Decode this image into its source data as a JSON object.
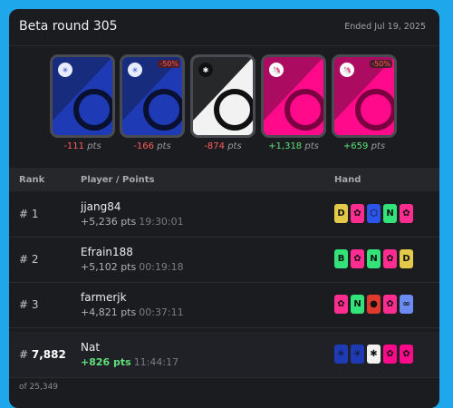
{
  "header": {
    "title": "Beta round 305",
    "ended": "Ended Jul 19, 2025"
  },
  "cards": [
    {
      "coin": "cardano",
      "coin_icon": "✳",
      "bg": "#1e3bb5",
      "coin_bg": "#e8ecff",
      "badge": "",
      "pts": "-111",
      "sign": "neg",
      "unit": "pts"
    },
    {
      "coin": "cardano",
      "coin_icon": "✳",
      "bg": "#1e3bb5",
      "coin_bg": "#e8ecff",
      "badge": "-50%",
      "pts": "-166",
      "sign": "neg",
      "unit": "pts"
    },
    {
      "coin": "stellar",
      "coin_icon": "✱",
      "bg": "#f2f2f2",
      "coin_bg": "#111111",
      "badge": "",
      "pts": "-874",
      "sign": "neg",
      "unit": "pts"
    },
    {
      "coin": "uniswap",
      "coin_icon": "🦄",
      "bg": "#ff0a8a",
      "coin_bg": "#ffffff",
      "badge": "",
      "pts": "+1,318",
      "sign": "pos",
      "unit": "pts"
    },
    {
      "coin": "uniswap",
      "coin_icon": "🦄",
      "bg": "#ff0a8a",
      "coin_bg": "#ffffff",
      "badge": "-50%",
      "pts": "+659",
      "sign": "pos",
      "unit": "pts"
    }
  ],
  "table": {
    "headers": {
      "rank": "Rank",
      "player": "Player / Points",
      "hand": "Hand"
    },
    "rows": [
      {
        "rank_prefix": "#",
        "rank": "1",
        "name": "jjang84",
        "points": "+5,236 pts",
        "time": "19:30:01",
        "hand": [
          {
            "c": "#e3c84a",
            "t": "D"
          },
          {
            "c": "#ff2d8f",
            "t": "✿"
          },
          {
            "c": "#2b54e8",
            "t": "⬡"
          },
          {
            "c": "#34e27a",
            "t": "N"
          },
          {
            "c": "#ff2d8f",
            "t": "✿"
          }
        ]
      },
      {
        "rank_prefix": "#",
        "rank": "2",
        "name": "Efrain188",
        "points": "+5,102 pts",
        "time": "00:19:18",
        "hand": [
          {
            "c": "#34e27a",
            "t": "B"
          },
          {
            "c": "#ff2d8f",
            "t": "✿"
          },
          {
            "c": "#34e27a",
            "t": "N"
          },
          {
            "c": "#ff2d8f",
            "t": "✿"
          },
          {
            "c": "#e3c84a",
            "t": "D"
          }
        ]
      },
      {
        "rank_prefix": "#",
        "rank": "3",
        "name": "farmerjk",
        "points": "+4,821 pts",
        "time": "00:37:11",
        "hand": [
          {
            "c": "#ff2d8f",
            "t": "✿"
          },
          {
            "c": "#34e27a",
            "t": "N"
          },
          {
            "c": "#e03a2e",
            "t": "●"
          },
          {
            "c": "#ff2d8f",
            "t": "✿"
          },
          {
            "c": "#6b8bf0",
            "t": "∞"
          }
        ]
      }
    ],
    "me": {
      "rank_prefix": "#",
      "rank": "7,882",
      "name": "Nat",
      "points": "+826 pts",
      "time": "11:44:17",
      "hand": [
        {
          "c": "#1e3bb5",
          "t": "✳"
        },
        {
          "c": "#1e3bb5",
          "t": "✳"
        },
        {
          "c": "#f2f2f2",
          "t": "✱"
        },
        {
          "c": "#ff0a8a",
          "t": "✿"
        },
        {
          "c": "#ff0a8a",
          "t": "✿"
        }
      ]
    }
  },
  "footer": {
    "text": "of 25,349"
  }
}
